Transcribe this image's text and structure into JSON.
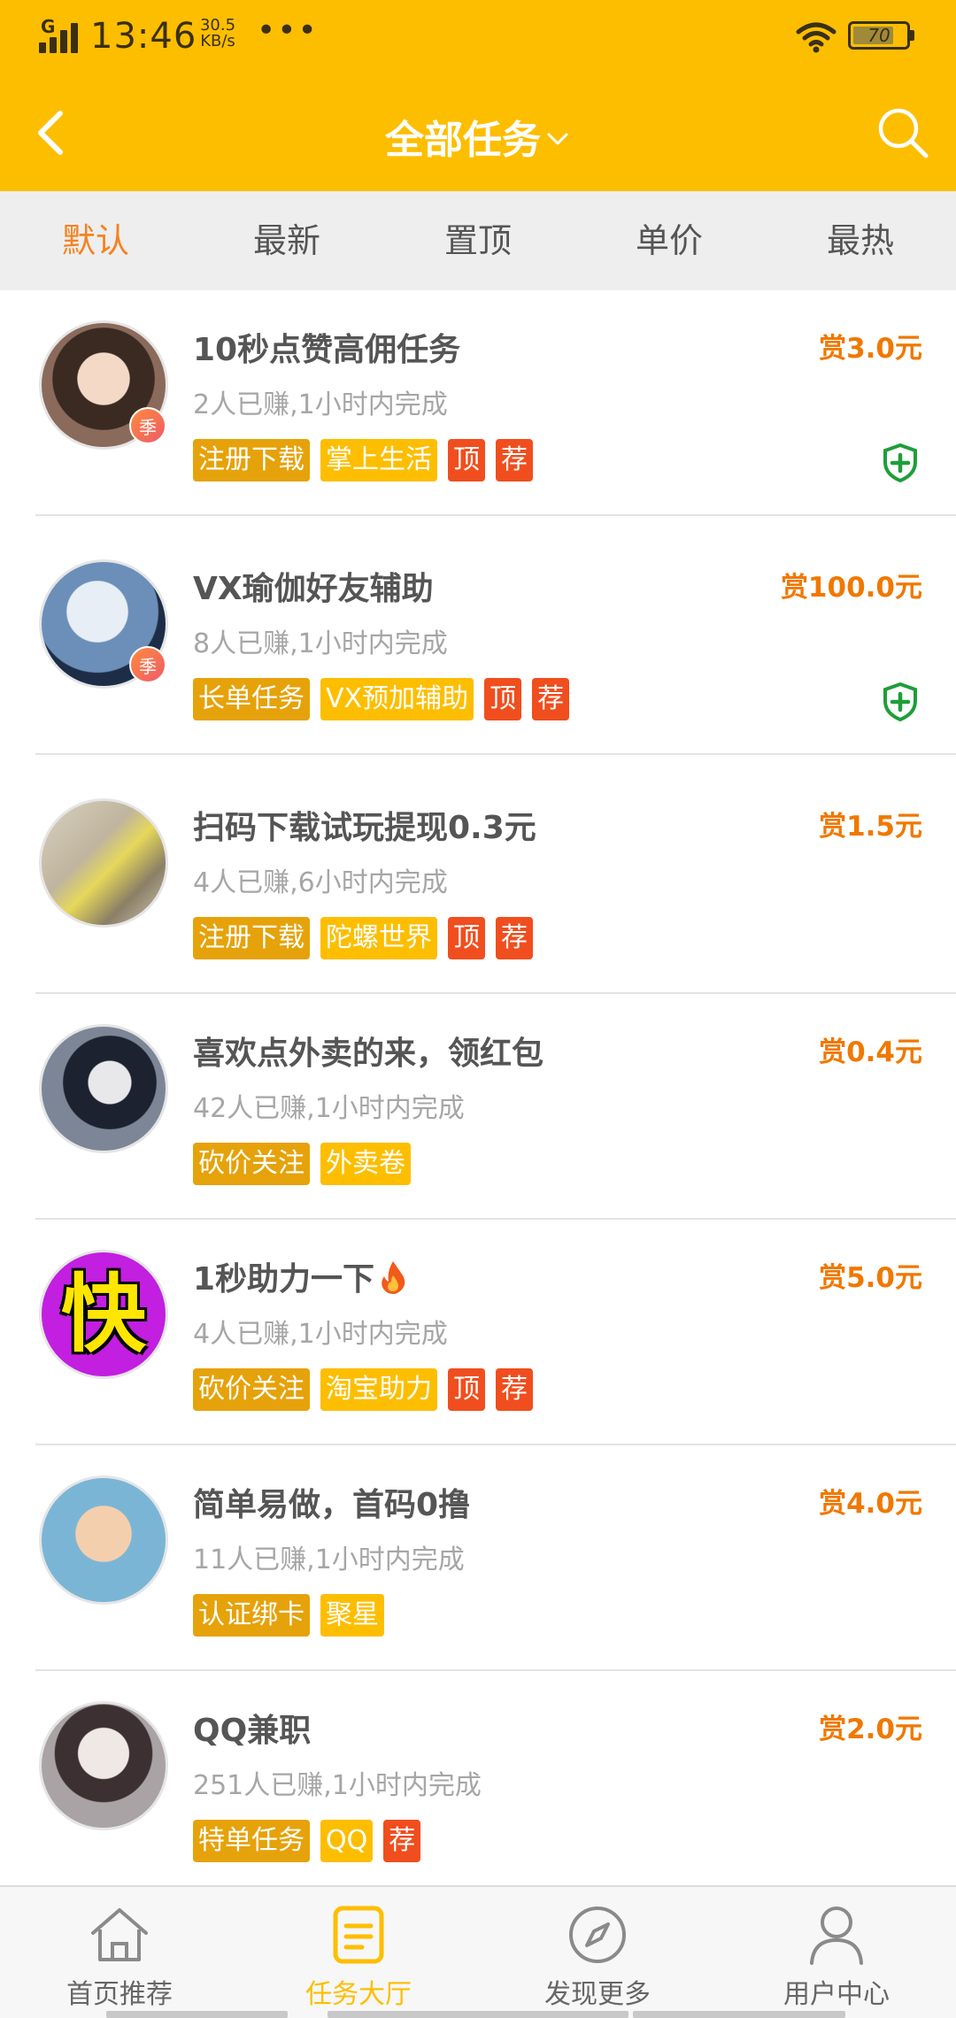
{
  "status_bar": {
    "network": "G",
    "time": "13:46",
    "speed_value": "30.5",
    "speed_unit": "KB/s",
    "more": "•••",
    "battery": "70"
  },
  "header": {
    "title": "全部任务",
    "back_icon": "chevron-left-icon",
    "dropdown_icon": "chevron-down-icon",
    "search_icon": "search-icon"
  },
  "sort_tabs": [
    {
      "label": "默认",
      "active": true
    },
    {
      "label": "最新",
      "active": false
    },
    {
      "label": "置顶",
      "active": false
    },
    {
      "label": "单价",
      "active": false
    },
    {
      "label": "最热",
      "active": false
    }
  ],
  "tasks": [
    {
      "title": "10秒点赞高佣任务",
      "stats": "2人已赚,1小时内完成",
      "reward": "赏3.0元",
      "badge": "季",
      "tags": [
        "注册下载",
        "掌上生活",
        "顶",
        "荐"
      ],
      "guarantee": true
    },
    {
      "title": "VX瑜伽好友辅助",
      "stats": "8人已赚,1小时内完成",
      "reward": "赏100.0元",
      "badge": "季",
      "tags": [
        "长单任务",
        "VX预加辅助",
        "顶",
        "荐"
      ],
      "guarantee": true
    },
    {
      "title": "扫码下载试玩提现0.3元",
      "stats": "4人已赚,6小时内完成",
      "reward": "赏1.5元",
      "tags": [
        "注册下载",
        "陀螺世界",
        "顶",
        "荐"
      ],
      "guarantee": false
    },
    {
      "title": "喜欢点外卖的来，领红包",
      "stats": "42人已赚,1小时内完成",
      "reward": "赏0.4元",
      "tags": [
        "砍价关注",
        "外卖卷"
      ],
      "guarantee": false
    },
    {
      "title": "1秒助力一下",
      "stats": "4人已赚,1小时内完成",
      "reward": "赏5.0元",
      "avatar_text": "快",
      "tags": [
        "砍价关注",
        "淘宝助力",
        "顶",
        "荐"
      ],
      "guarantee": false
    },
    {
      "title": "简单易做，首码0撸",
      "stats": "11人已赚,1小时内完成",
      "reward": "赏4.0元",
      "tags": [
        "认证绑卡",
        "聚星"
      ],
      "guarantee": false
    },
    {
      "title": "QQ兼职",
      "stats": "251人已赚,1小时内完成",
      "reward": "赏2.0元",
      "tags": [
        "特单任务",
        "QQ",
        "荐"
      ],
      "guarantee": false
    }
  ],
  "bottom_nav": [
    {
      "label": "首页推荐",
      "icon": "home-icon",
      "active": false
    },
    {
      "label": "任务大厅",
      "icon": "task-list-icon",
      "active": true
    },
    {
      "label": "发现更多",
      "icon": "compass-icon",
      "active": false
    },
    {
      "label": "用户中心",
      "icon": "user-icon",
      "active": false
    }
  ],
  "colors": {
    "brand": "#FDBE00",
    "accent_orange": "#F07800",
    "tag_dark": "#E6A20A",
    "tag_red": "#F04E1E",
    "guarantee_green": "#1E9E3A"
  }
}
